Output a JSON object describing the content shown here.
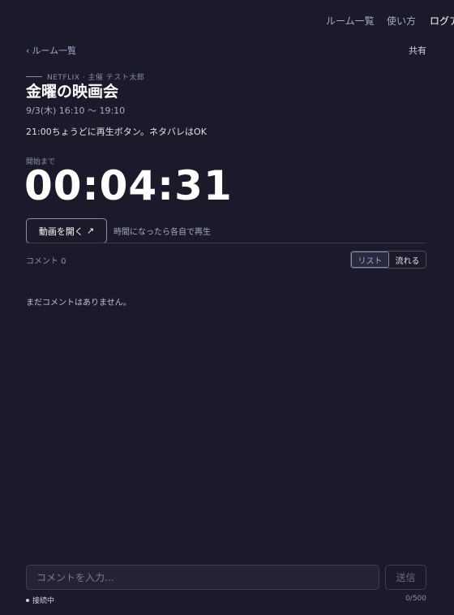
{
  "nav": {
    "rooms": "ルーム一覧",
    "howto": "使い方",
    "login": "ログア"
  },
  "subbar": {
    "back_label": "ルーム一覧",
    "share": "共有"
  },
  "room": {
    "meta": "NETFLIX · 主催 テスト太郎",
    "title": "金曜の映画会",
    "schedule": "9/3(木) 16:10 〜 19:10",
    "description": "21:00ちょうどに再生ボタン。ネタバレはOK"
  },
  "countdown": {
    "label": "開始まで",
    "value": "00:04:31"
  },
  "actions": {
    "open_video": "動画を開く",
    "open_hint": "時間になったら各自で再生"
  },
  "comments": {
    "count_label": "コメント 0",
    "view_list": "リスト",
    "view_flow": "流れる",
    "active_view": "list",
    "empty": "まだコメントはありません。"
  },
  "composer": {
    "placeholder": "コメントを入力...",
    "value": "",
    "send": "送信",
    "status": "接続中",
    "char_count": "0/500"
  },
  "colors": {
    "background": "#1a1a2a",
    "accent": "#a8a8cc",
    "text": "#ffffff"
  },
  "icons": {
    "back": "chevron-left-icon",
    "external": "external-link-icon",
    "status": "dot-icon"
  }
}
